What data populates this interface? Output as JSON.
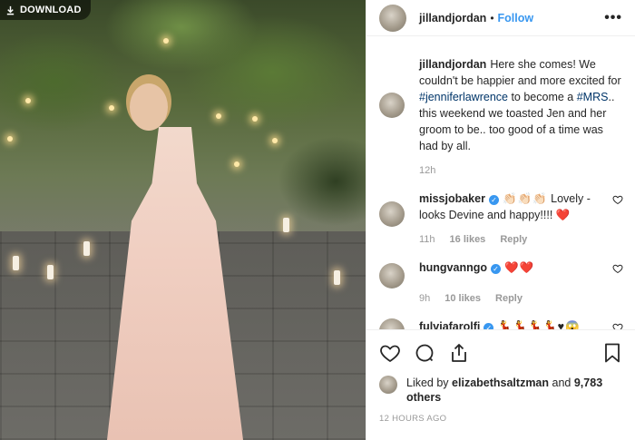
{
  "photo": {
    "download_label": "DOWNLOAD"
  },
  "header": {
    "username": "jillandjordan",
    "separator": "•",
    "follow_label": "Follow",
    "more_label": "•••"
  },
  "caption": {
    "username": "jillandjordan",
    "text_1": "Here she comes! We couldn't be happier and more excited for ",
    "hashtag_1": "#jenniferlawrence",
    "text_2": " to become a ",
    "hashtag_2": "#MRS",
    "text_3": ".. this weekend we toasted Jen and her groom to be.. too good of a time was had by all.",
    "time": "12h"
  },
  "comments": [
    {
      "username": "missjobaker",
      "verified": true,
      "emoji": "👏🏻👏🏻👏🏻",
      "text": "Lovely - looks Devine and happy!!!!",
      "trailing_emoji": "❤️",
      "time": "11h",
      "likes": "16 likes",
      "reply": "Reply"
    },
    {
      "username": "hungvanngo",
      "verified": true,
      "emoji": "❤️❤️",
      "text": "",
      "time": "9h",
      "likes": "10 likes",
      "reply": "Reply"
    },
    {
      "username": "fulviafarolfi",
      "verified": true,
      "emoji": "💃💃💃💃♥😱"
    }
  ],
  "liked_by": {
    "prefix": "Liked by",
    "user": "elizabethsaltzman",
    "and": "and",
    "count": "9,783 others"
  },
  "timestamp": "12 HOURS AGO",
  "icons": {
    "like": "heart-icon",
    "comment": "comment-icon",
    "share": "share-icon",
    "save": "bookmark-icon",
    "download": "download-icon"
  },
  "colors": {
    "accent": "#3897f0",
    "hashtag": "#003569",
    "muted": "#999999",
    "text": "#262626",
    "heart_red": "#ed4956"
  }
}
